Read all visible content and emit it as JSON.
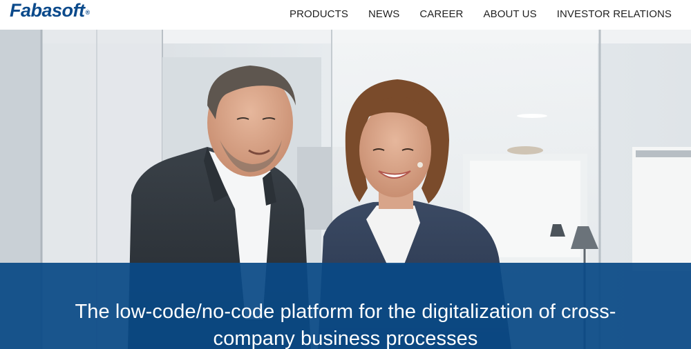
{
  "brand": {
    "name": "Fabasoft",
    "registered_mark": "®",
    "color": "#0b4a8b"
  },
  "nav": {
    "items": [
      {
        "label": "PRODUCTS"
      },
      {
        "label": "NEWS"
      },
      {
        "label": "CAREER"
      },
      {
        "label": "ABOUT US"
      },
      {
        "label": "INVESTOR RELATIONS"
      }
    ]
  },
  "hero": {
    "image_subject": "two business people looking at a tablet in an office",
    "banner_color": "#0a4985",
    "headline": "The low-code/no-code platform for the digitalization of cross-company business processes"
  }
}
